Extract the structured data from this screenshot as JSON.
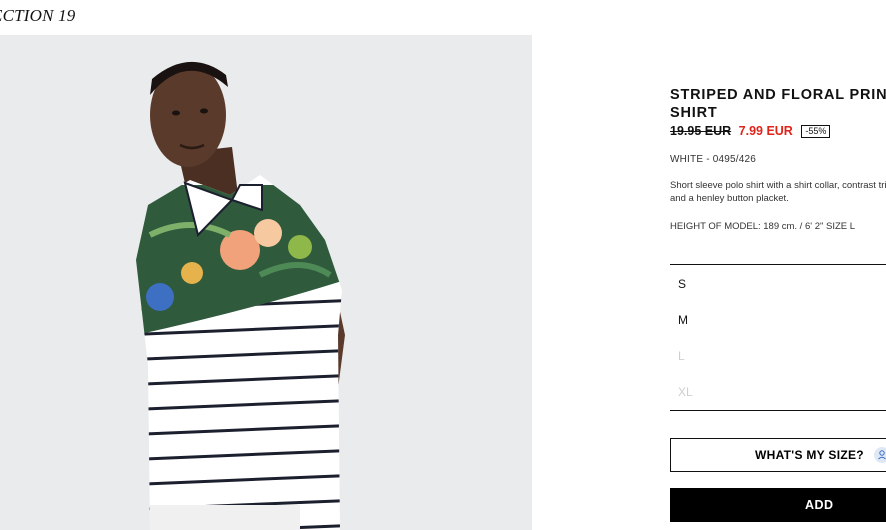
{
  "header": {
    "collection_title": "ECTION 19",
    "logo_icon": "brand-logo-icon"
  },
  "product": {
    "name": "STRIPED AND FLORAL PRINT SHIRT",
    "old_price": "19.95 EUR",
    "new_price": "7.99 EUR",
    "discount": "-55%",
    "color_ref": "WHITE - 0495/426",
    "description": "Short sleeve polo shirt with a shirt collar, contrast trims and a henley button placket.",
    "model_height": "HEIGHT OF MODEL: 189 cm. / 6' 2\" SIZE L",
    "image_icon": "product-photo"
  },
  "sizes": [
    {
      "label": "S",
      "available": true
    },
    {
      "label": "M",
      "available": true
    },
    {
      "label": "L",
      "available": false
    },
    {
      "label": "XL",
      "available": false
    }
  ],
  "actions": {
    "size_help_label": "WHAT'S MY SIZE?",
    "size_help_icon": "ruler-icon",
    "add_label": "ADD"
  },
  "colors": {
    "sale_price": "#e2231a",
    "add_button_bg": "#000000",
    "unavailable_size": "#cfcfcf",
    "image_bg": "#e9ebec"
  }
}
